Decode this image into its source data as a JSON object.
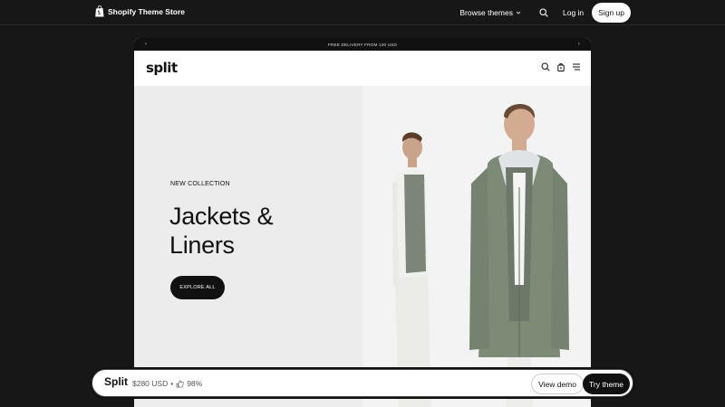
{
  "store_nav": {
    "brand": "Shopify Theme Store",
    "browse": "Browse themes",
    "login": "Log in",
    "signup": "Sign up"
  },
  "preview": {
    "announcement": "FREE DELIVERY FROM 130 USD",
    "logo": "split",
    "hero": {
      "eyebrow": "NEW COLLECTION",
      "headline_line1": "Jackets &",
      "headline_line2": "Liners",
      "cta": "EXPLORE ALL"
    }
  },
  "bottom_bar": {
    "theme_name": "Split",
    "price": "$280 USD",
    "separator": "•",
    "rating": "98%",
    "view_demo": "View demo",
    "try_theme": "Try theme"
  },
  "icons": {
    "brand": "shopify-bag-icon",
    "search": "search-icon",
    "cart": "cart-icon",
    "menu": "hamburger-menu-icon",
    "rating": "thumbs-up-icon"
  }
}
